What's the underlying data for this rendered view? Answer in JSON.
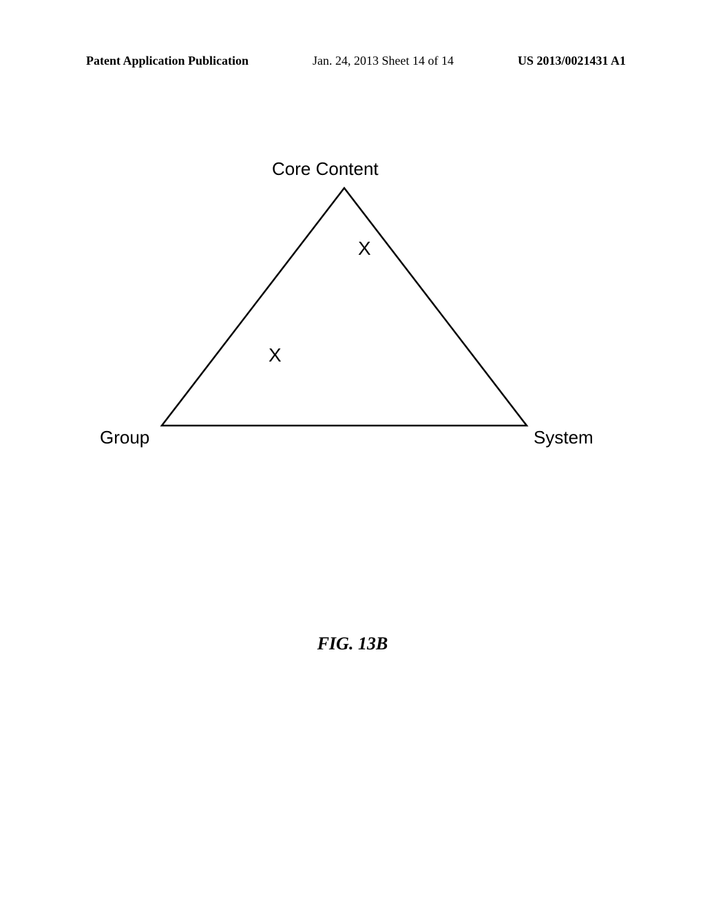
{
  "header": {
    "left": "Patent Application Publication",
    "center": "Jan. 24, 2013  Sheet 14 of 14",
    "right": "US 2013/0021431 A1"
  },
  "diagram": {
    "topLabel": "Core Content",
    "leftLabel": "Group",
    "rightLabel": "System",
    "mark1": "X",
    "mark2": "X"
  },
  "caption": "FIG. 13B"
}
